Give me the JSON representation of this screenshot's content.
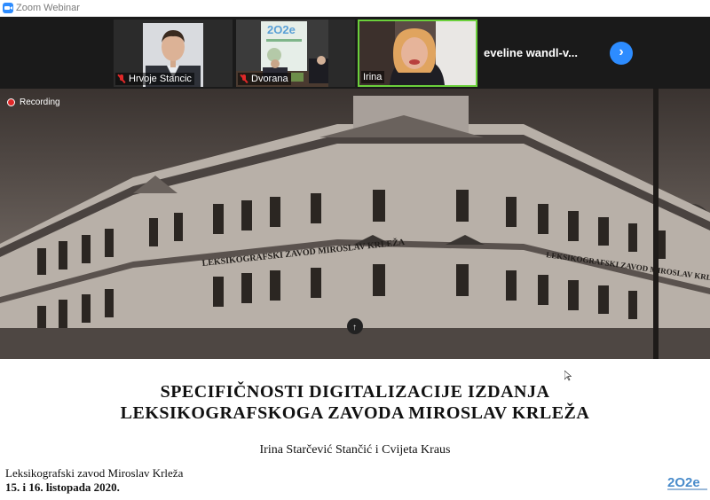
{
  "window": {
    "title": "Zoom Webinar"
  },
  "participants": [
    {
      "name": "Hrvoje Stancic",
      "muted": true
    },
    {
      "name": "Dvorana",
      "muted": true
    },
    {
      "name": "Irina",
      "muted": false,
      "active_speaker": true
    },
    {
      "name": "eveline  wandl-v..."
    }
  ],
  "recording": {
    "label": "Recording"
  },
  "slide": {
    "photo_signs": [
      "LEKSIKOGRAFSKI ZAVOD MIROSLAV KRLEŽA",
      "LEKSIKOGRAFSKI ZAVOD MIROSLAV KRLEŽA"
    ],
    "title_line1": "SPECIFIČNOSTI DIGITALIZACIJE IZDANJA",
    "title_line2": "LEKSIKOGRAFSKOGA ZAVODA MIROSLAV KRLEŽA",
    "authors": "Irina Starčević Stančić i Cvijeta Kraus",
    "organization": "Leksikografski zavod Miroslav Krleža",
    "date": "15. i 16. listopada 2020.",
    "logo": "2O2e"
  },
  "icons": {
    "app": "zoom-camera-icon",
    "mute": "mic-muted-icon",
    "next": "chevron-right-icon",
    "recording": "record-icon"
  },
  "colors": {
    "accent": "#2d8cff",
    "active_speaker": "#6bd03b",
    "muted": "#e02828"
  }
}
